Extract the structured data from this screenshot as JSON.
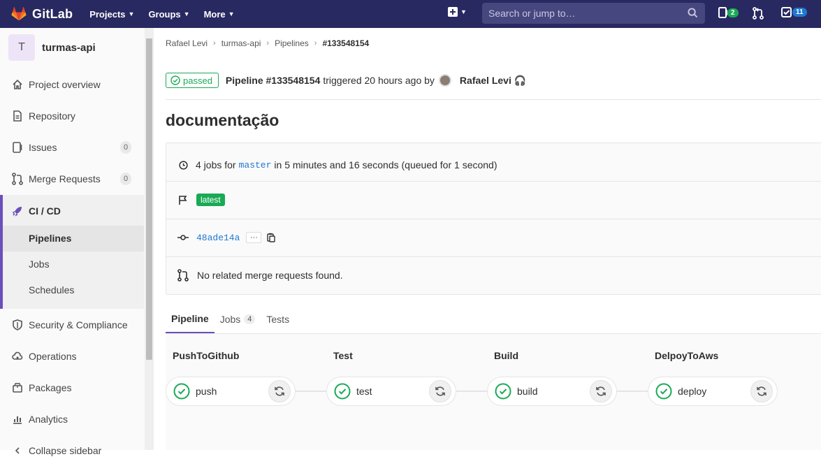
{
  "topbar": {
    "brand": "GitLab",
    "nav": [
      {
        "label": "Projects"
      },
      {
        "label": "Groups"
      },
      {
        "label": "More"
      }
    ],
    "search_placeholder": "Search or jump to…",
    "issues_count": "2",
    "todos_count": "11"
  },
  "sidebar": {
    "project_initial": "T",
    "project_name": "turmas-api",
    "items": [
      {
        "label": "Project overview"
      },
      {
        "label": "Repository"
      },
      {
        "label": "Issues",
        "count": "0"
      },
      {
        "label": "Merge Requests",
        "count": "0"
      },
      {
        "label": "CI / CD"
      },
      {
        "label": "Security & Compliance"
      },
      {
        "label": "Operations"
      },
      {
        "label": "Packages"
      },
      {
        "label": "Analytics"
      },
      {
        "label": "Collapse sidebar"
      }
    ],
    "cicd_sub": [
      {
        "label": "Pipelines"
      },
      {
        "label": "Jobs"
      },
      {
        "label": "Schedules"
      }
    ]
  },
  "breadcrumb": [
    "Rafael Levi",
    "turmas-api",
    "Pipelines",
    "#133548154"
  ],
  "header": {
    "status": "passed",
    "pipeline_label": "Pipeline #133548154",
    "triggered_text": "triggered 20 hours ago by",
    "user": "Rafael Levi",
    "user_emoji": "🎧"
  },
  "title": "documentação",
  "info": {
    "jobs_prefix": "4 jobs for",
    "branch": "master",
    "jobs_suffix": "in 5 minutes and 16 seconds (queued for 1 second)",
    "tag": "latest",
    "commit": "48ade14a",
    "ellipsis": "···",
    "mr_text": "No related merge requests found."
  },
  "tabs": [
    {
      "label": "Pipeline"
    },
    {
      "label": "Jobs",
      "count": "4"
    },
    {
      "label": "Tests"
    }
  ],
  "stages": [
    {
      "name": "PushToGithub",
      "job": "push"
    },
    {
      "name": "Test",
      "job": "test"
    },
    {
      "name": "Build",
      "job": "build"
    },
    {
      "name": "DelpoyToAws",
      "job": "deploy"
    }
  ],
  "colors": {
    "topbar": "#292961",
    "accent": "#6b4fbb",
    "success": "#1aaa55",
    "link": "#1f78d1"
  }
}
